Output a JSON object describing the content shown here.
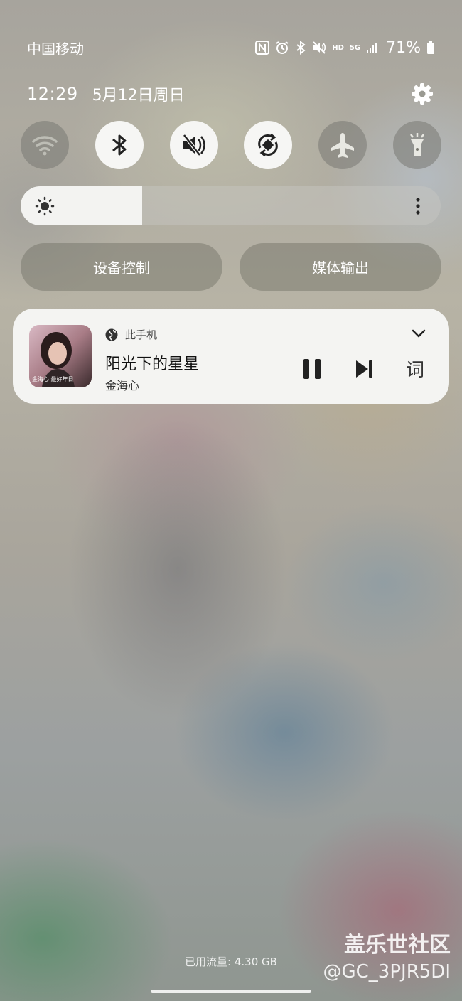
{
  "status_bar": {
    "carrier": "中国移动",
    "icons": [
      "nfc-icon",
      "alarm-icon",
      "bluetooth-icon",
      "mute-icon",
      "hd-icon",
      "5g-icon",
      "signal-icon",
      "battery-icon"
    ],
    "hd": "HD",
    "network": "5G",
    "battery_percent": "71%"
  },
  "header": {
    "time": "12:29",
    "date": "5月12日周日"
  },
  "quick_toggles": [
    {
      "name": "wifi",
      "state": "off"
    },
    {
      "name": "bluetooth",
      "state": "on"
    },
    {
      "name": "mute",
      "state": "on"
    },
    {
      "name": "auto-rotate",
      "state": "on"
    },
    {
      "name": "airplane-mode",
      "state": "off"
    },
    {
      "name": "flashlight",
      "state": "off"
    }
  ],
  "brightness": {
    "level": 0.29
  },
  "buttons": {
    "device_control": "设备控制",
    "media_output": "媒体输出"
  },
  "media": {
    "output_device": "此手机",
    "title": "阳光下的星星",
    "artist": "金海心",
    "album_text": "金海心 最好年日",
    "lyrics_label": "词"
  },
  "footer": {
    "data_usage": "已用流量: 4.30 GB"
  },
  "watermark": {
    "title": "盖乐世社区",
    "handle": "@GC_3PJR5DI"
  },
  "colors": {
    "toggle_on": "#f6f6f4",
    "toggle_off": "#78786f",
    "card_bg": "#f4f4f2"
  }
}
